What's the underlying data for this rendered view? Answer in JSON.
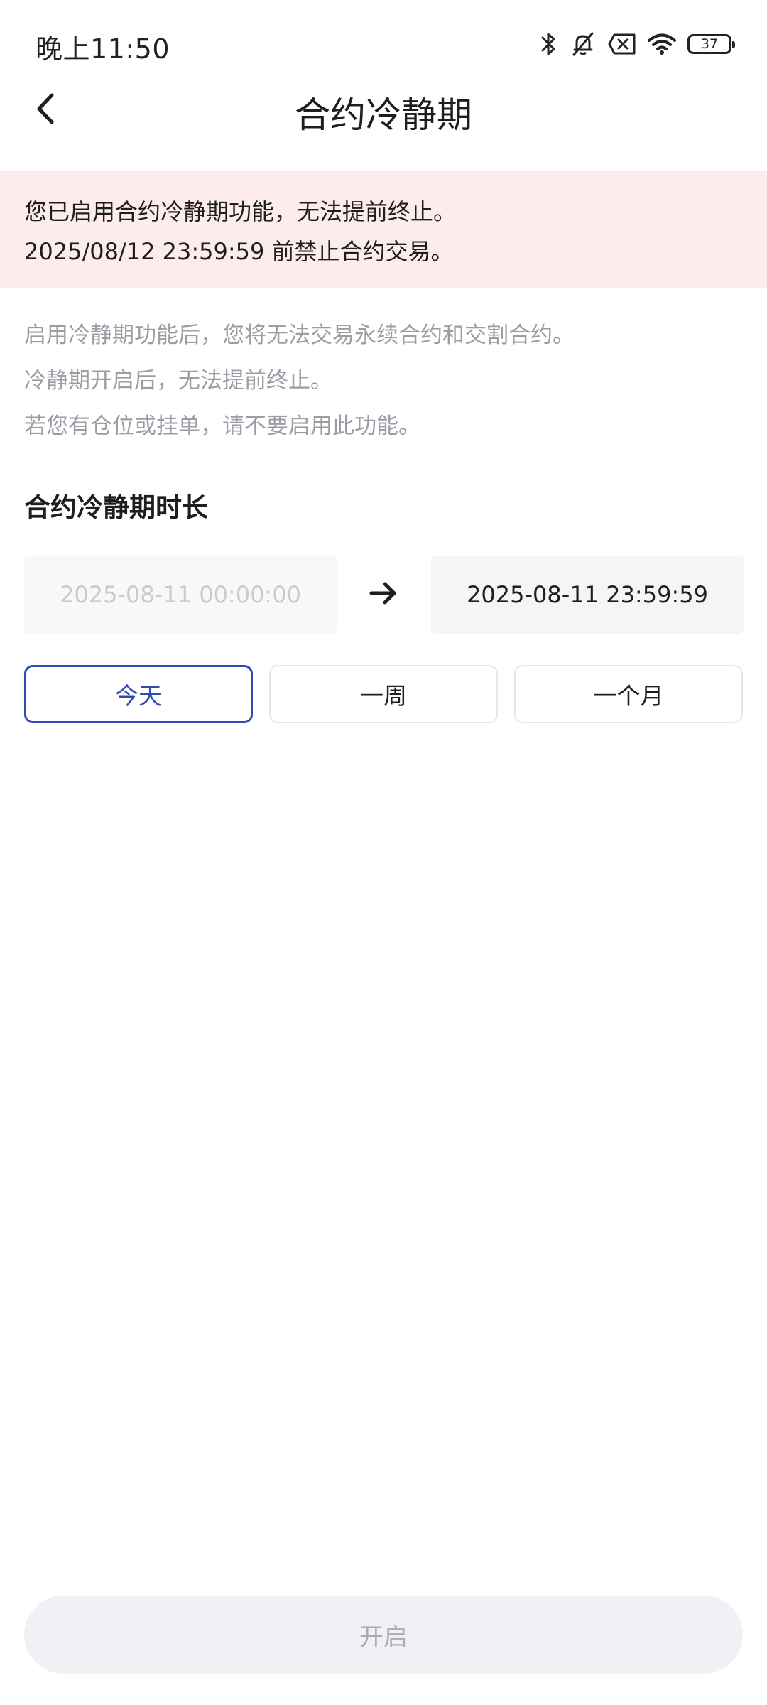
{
  "status_bar": {
    "time": "晚上11:50",
    "battery": "37",
    "icons": [
      "bluetooth-icon",
      "bell-muted-icon",
      "sim-off-icon",
      "wifi-icon",
      "battery-icon"
    ]
  },
  "header": {
    "title": "合约冷静期",
    "back_icon": "chevron-left-icon"
  },
  "warning": {
    "line1": "您已启用合约冷静期功能，无法提前终止。",
    "line2": "2025/08/12 23:59:59 前禁止合约交易。",
    "background": "#fdecec"
  },
  "description": {
    "lines": [
      "启用冷静期功能后，您将无法交易永续合约和交割合约。",
      "冷静期开启后，无法提前终止。",
      "若您有仓位或挂单，请不要启用此功能。"
    ]
  },
  "duration": {
    "title": "合约冷静期时长",
    "start": "2025-08-11 00:00:00",
    "end": "2025-08-11 23:59:59",
    "arrow_icon": "arrow-right-icon"
  },
  "periods": [
    {
      "label": "今天",
      "selected": true
    },
    {
      "label": "一周",
      "selected": false
    },
    {
      "label": "一个月",
      "selected": false
    }
  ],
  "submit": {
    "label": "开启",
    "enabled": false
  },
  "colors": {
    "accent": "#2e4db3",
    "muted_text": "#9a9da3",
    "disabled_bg": "#f0f1f4"
  }
}
